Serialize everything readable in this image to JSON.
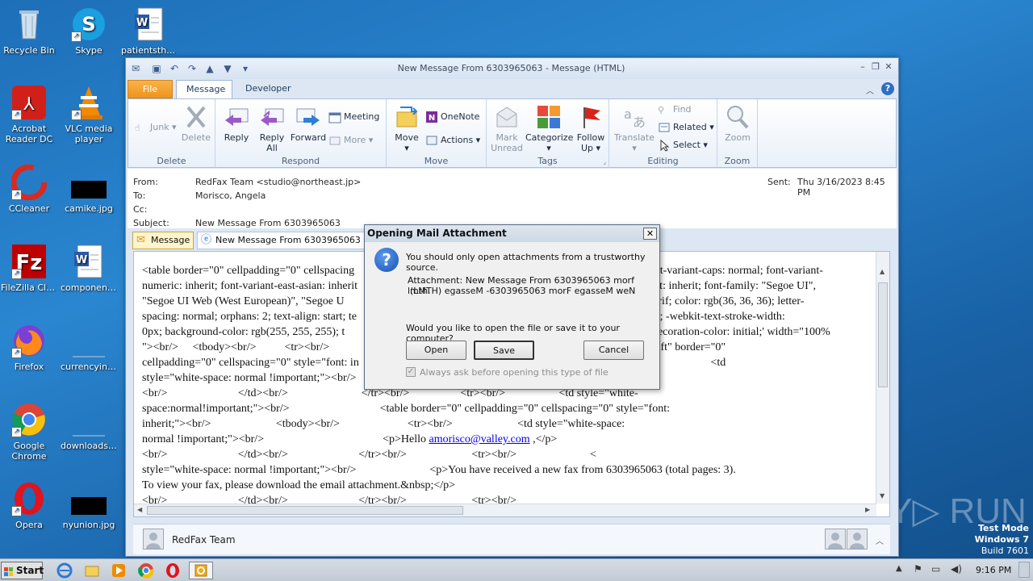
{
  "desktop": {
    "icons": [
      {
        "label": "Recycle Bin"
      },
      {
        "label": "Skype"
      },
      {
        "label": "patientsthe..."
      },
      {
        "label": "Acrobat Reader DC"
      },
      {
        "label": "VLC media player"
      },
      {
        "label": "CCleaner"
      },
      {
        "label": "camike.jpg"
      },
      {
        "label": "FileZilla Client"
      },
      {
        "label": "component..."
      },
      {
        "label": "Firefox"
      },
      {
        "label": "currencyint..."
      },
      {
        "label": "Google Chrome"
      },
      {
        "label": "downloadsj..."
      },
      {
        "label": "Opera"
      },
      {
        "label": "nyunion.jpg"
      }
    ],
    "watermark": {
      "left": "ANY",
      "right": "RUN",
      "test_mode": "Test Mode",
      "os": "Windows 7",
      "build": "Build 7601"
    }
  },
  "window": {
    "title": "New Message From 6303965063  -  Message (HTML)",
    "tabs": {
      "file": "File",
      "message": "Message",
      "developer": "Developer"
    }
  },
  "ribbon": {
    "delete_group": {
      "junk": "Junk",
      "delete": "Delete",
      "label": "Delete"
    },
    "respond_group": {
      "reply": "Reply",
      "reply_all_1": "Reply",
      "reply_all_2": "All",
      "forward": "Forward",
      "meeting": "Meeting",
      "more": "More",
      "label": "Respond"
    },
    "move_group": {
      "move": "Move",
      "onenote": "OneNote",
      "actions": "Actions",
      "label": "Move"
    },
    "tags_group": {
      "mark_unread_1": "Mark",
      "mark_unread_2": "Unread",
      "categorize": "Categorize",
      "follow_up_1": "Follow",
      "follow_up_2": "Up",
      "label": "Tags"
    },
    "editing_group": {
      "translate": "Translate",
      "find": "Find",
      "related": "Related",
      "select": "Select",
      "label": "Editing"
    },
    "zoom_group": {
      "zoom": "Zoom",
      "label": "Zoom"
    }
  },
  "header": {
    "from_label": "From:",
    "from_value": "RedFax Team <studio@northeast.jp>",
    "to_label": "To:",
    "to_value": "Morisco, Angela",
    "cc_label": "Cc:",
    "subject_label": "Subject:",
    "subject_value": "New Message From 6303965063",
    "sent_label": "Sent:",
    "sent_value": "Thu 3/16/2023 8:45 PM"
  },
  "message_tabs": {
    "message": "Message",
    "attachment": "New Message From 6303965063 html"
  },
  "body": {
    "line1": "<table border=\"0\" cellpadding=\"0\" cellspacing",
    "line1b": "font-variant-caps: normal; font-variant-",
    "line2": "numeric: inherit; font-variant-east-asian: inherit",
    "line2b": "eight: inherit; font-family: \"Segoe UI\",",
    "line3": "\"Segoe UI Web (West European)\", \"Segoe U",
    "line3b": "ns-serif; color: rgb(36, 36, 36); letter-",
    "line4": "spacing: normal; orphans: 2; text-align: start; te",
    "line4b": "pacing: 0px; -webkit-text-stroke-width:",
    "line5": "0px; background-color: rgb(255, 255, 255); t",
    "line5b": "text-decoration-color: initial;' width=\"100%",
    "line6": "\"><br/>     <tbody><br/>          <tr><br/>",
    "line6b": "<table align=\"left\" border=\"0\"",
    "line7": "cellpadding=\"0\" cellspacing=\"0\" style=\"font: in",
    "line7b": "<tr><br/>                    <td",
    "line8": "style=\"white-space: normal !important;\"><br/>",
    "line9": "<br/>                         </td><br/>                          </tr><br/>                  <tr><br/>                   <td style=\"white-",
    "line10": "space:normal!important;\"><br/>                                <table border=\"0\" cellpadding=\"0\" cellspacing=\"0\" style=\"font:",
    "line11": "inherit;\"><br/>                       <tbody><br/>                        <tr><br/>                       <td style=\"white-space:",
    "line12a": "normal !important;\"><br/>                                          <p>Hello ",
    "line12link": "amorisco@valley.com",
    "line12b": " ,</p>",
    "line13": "<br/>                         </td><br/>                         </tr><br/>                       <tr><br/>                          <",
    "line14": "style=\"white-space: normal !important;\"><br/>                          <p>You have received a new fax from 6303965063 (total pages: 3).",
    "line15": "To view your fax, please download the email attachment.&nbsp;</p>",
    "line16": "<br/>                         </td><br/>                         </tr><br/>                       <tr><br/>"
  },
  "people_pane": {
    "name": "RedFax Team"
  },
  "dialog": {
    "title": "Opening Mail Attachment",
    "warning": "You should only open attachments from a trustworthy source.",
    "attachment_line1": "Attachment: New Message From 6303965063  morf lmth.",
    "attachment_line2": "(LMTH) egasseM -6303965063  morF egasseM weN",
    "question": "Would you like to open the file or save it to your computer?",
    "open": "Open",
    "save": "Save",
    "cancel": "Cancel",
    "checkbox": "Always ask before opening this type of file"
  },
  "taskbar": {
    "start": "Start",
    "clock": "9:16 PM"
  }
}
